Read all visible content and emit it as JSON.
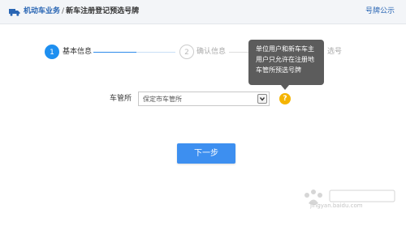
{
  "header": {
    "breadcrumb_parent": "机动车业务",
    "separator": "/",
    "breadcrumb_current": "新车注册登记预选号牌",
    "notice_link": "号牌公示"
  },
  "stepper": {
    "steps": [
      {
        "number": "1",
        "label": "基本信息"
      },
      {
        "number": "2",
        "label": "确认信息"
      },
      {
        "label": "选号"
      }
    ]
  },
  "tooltip": {
    "lines": [
      "单位用户和新车车主",
      "用户只允许在注册地",
      "车管所预选号牌"
    ]
  },
  "form": {
    "office_label": "车管所",
    "office_value": "保定市车管所",
    "help_icon_text": "?"
  },
  "actions": {
    "next_label": "下一步"
  },
  "watermark": {
    "text": "jingyan.baidu.com"
  },
  "colors": {
    "accent": "#1e8ff0",
    "button": "#3d8ff0",
    "link": "#2a66b4",
    "tooltip_bg": "#5c5c5c",
    "help_icon": "#f5b400"
  }
}
